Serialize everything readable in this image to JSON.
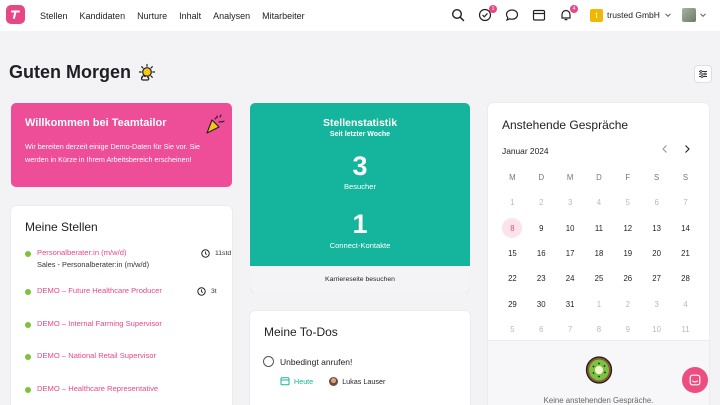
{
  "nav": {
    "items": [
      "Stellen",
      "Kandidaten",
      "Nurture",
      "Inhalt",
      "Analysen",
      "Mitarbeiter"
    ],
    "badges": {
      "activity": "1",
      "notifications": "4"
    },
    "company": "trusted GmbH",
    "company_initial": "t"
  },
  "page": {
    "greeting": "Guten Morgen"
  },
  "welcome": {
    "title": "Willkommen bei Teamtailor",
    "text": "Wir bereiten derzeit einige Demo-Daten für Sie vor. Sie werden in Kürze in Ihrem Arbeitsbereich erscheinen!"
  },
  "jobs": {
    "title": "Meine Stellen",
    "items": [
      {
        "title": "Personalberater:in (m/w/d)",
        "sub": "Sales - Personalberater:in (m/w/d)",
        "time": "11std"
      },
      {
        "title": "DEMO – Future Healthcare Producer",
        "sub": "",
        "time": "3t"
      },
      {
        "title": "DEMO – Internal Farming Supervisor",
        "sub": "",
        "time": ""
      },
      {
        "title": "DEMO – National Retail Supervisor",
        "sub": "",
        "time": ""
      },
      {
        "title": "DEMO – Healthcare Representative",
        "sub": "",
        "time": ""
      }
    ]
  },
  "stats": {
    "title": "Stellenstatistik",
    "subtitle": "Seit letzter Woche",
    "visitors_value": "3",
    "visitors_label": "Besucher",
    "connect_value": "1",
    "connect_label": "Connect-Kontakte",
    "footer_link": "Karriereseite besuchen"
  },
  "todos": {
    "title": "Meine To-Dos",
    "items": [
      {
        "text": "Unbedingt anrufen!",
        "date": "Heute",
        "assignee": "Lukas Lauser"
      }
    ]
  },
  "calendar": {
    "title": "Anstehende Gespräche",
    "month": "Januar 2024",
    "weekdays": [
      "M",
      "D",
      "M",
      "D",
      "F",
      "S",
      "S"
    ],
    "weeks": [
      [
        "1",
        "2",
        "3",
        "4",
        "5",
        "6",
        "7"
      ],
      [
        "8",
        "9",
        "10",
        "11",
        "12",
        "13",
        "14"
      ],
      [
        "15",
        "16",
        "17",
        "18",
        "19",
        "20",
        "21"
      ],
      [
        "22",
        "23",
        "24",
        "25",
        "26",
        "27",
        "28"
      ],
      [
        "29",
        "30",
        "31",
        "1",
        "2",
        "3",
        "4"
      ],
      [
        "5",
        "6",
        "7",
        "8",
        "9",
        "10",
        "11"
      ]
    ],
    "muted_weeks": [
      0,
      5
    ],
    "muted_from": {
      "4": 3
    },
    "today": "8",
    "empty_text": "Keine anstehenden Gespräche."
  },
  "colors": {
    "brand": "#e84785",
    "teal": "#14b59c",
    "green_dot": "#7dc23a"
  },
  "icons": [
    "search-icon",
    "checklist-icon",
    "chat-icon",
    "calendar-icon",
    "bell-icon",
    "chevron-down-icon",
    "filter-icon",
    "party-icon",
    "clock-icon",
    "kiwi-icon",
    "messenger-icon"
  ]
}
